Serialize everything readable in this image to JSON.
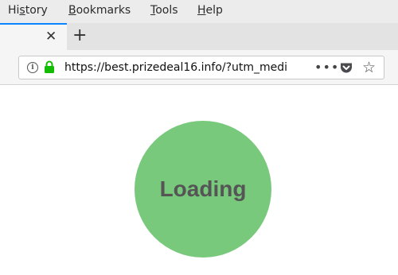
{
  "menubar": {
    "items": [
      {
        "pre": "Hi",
        "u": "s",
        "post": "tory"
      },
      {
        "pre": "",
        "u": "B",
        "post": "ookmarks"
      },
      {
        "pre": "",
        "u": "T",
        "post": "ools"
      },
      {
        "pre": "",
        "u": "H",
        "post": "elp"
      }
    ]
  },
  "tabs": {
    "close_glyph": "✕",
    "new_tab_glyph": "+"
  },
  "urlbar": {
    "url": "https://best.prizedeal16.info/?utm_medi",
    "info_icon": "i",
    "secure_color": "#12bc00"
  },
  "page": {
    "loading_label": "Loading",
    "circle_color": "#78c97c"
  }
}
